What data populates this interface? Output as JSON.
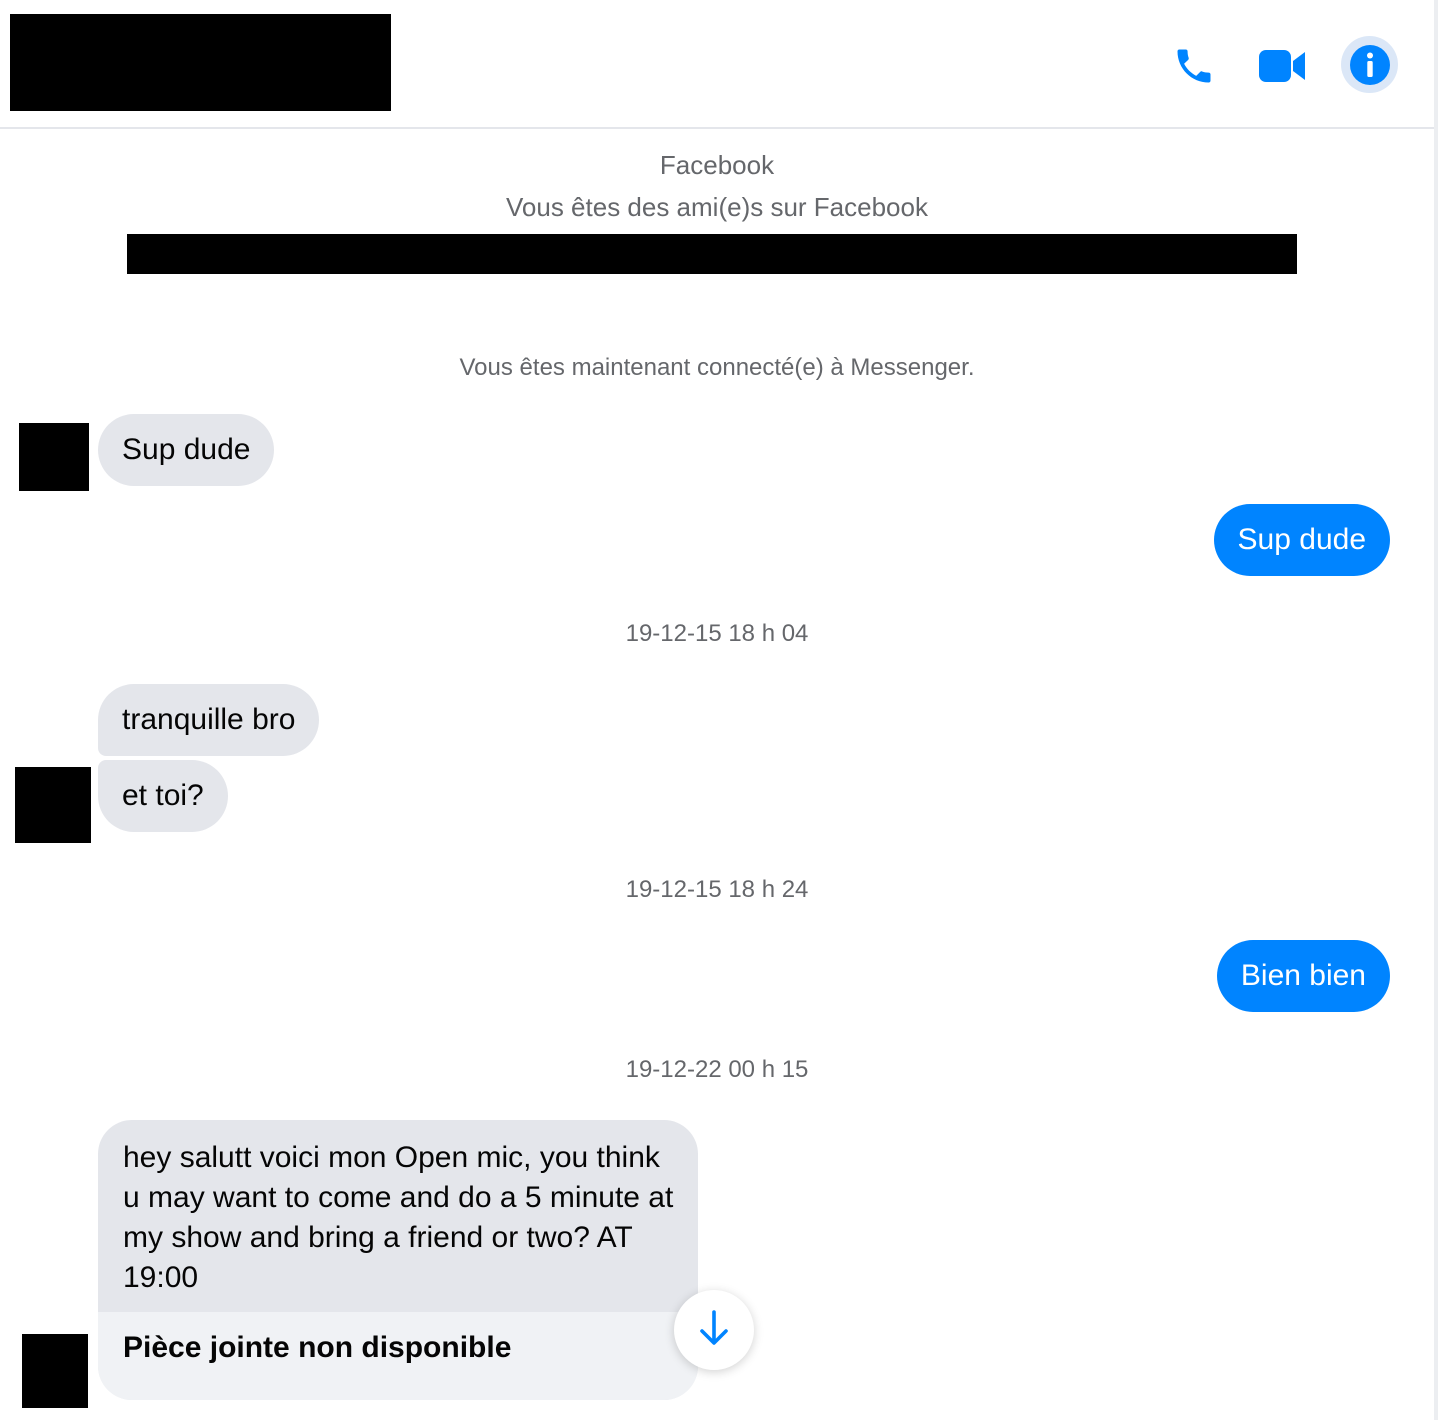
{
  "header": {
    "call_icon": "phone-icon",
    "video_icon": "video-camera-icon",
    "info_icon": "info-icon",
    "accent_color": "#0084ff"
  },
  "context": {
    "platform": "Facebook",
    "friends_note": "Vous êtes des ami(e)s sur Facebook",
    "connected_note": "Vous êtes maintenant connecté(e) à Messenger."
  },
  "messages": [
    {
      "text": "Sup dude"
    },
    {
      "text": "Sup dude"
    },
    {
      "timestamp": "19-12-15 18 h 04"
    },
    {
      "text": "tranquille bro"
    },
    {
      "text": "et toi?"
    },
    {
      "timestamp": "19-12-15 18 h 24"
    },
    {
      "text": "Bien bien"
    },
    {
      "timestamp": "19-12-22 00 h 15"
    },
    {
      "text": "hey salutt voici mon Open mic, you think u may want to come and do a 5 minute at my show and bring a friend or two? AT 19:00",
      "attachment": "Pièce jointe non disponible"
    }
  ],
  "scroll_button_icon": "arrow-down-icon",
  "colors": {
    "incoming_bubble": "#e4e6eb",
    "outgoing_bubble": "#0084ff",
    "meta_text": "#65676b"
  }
}
